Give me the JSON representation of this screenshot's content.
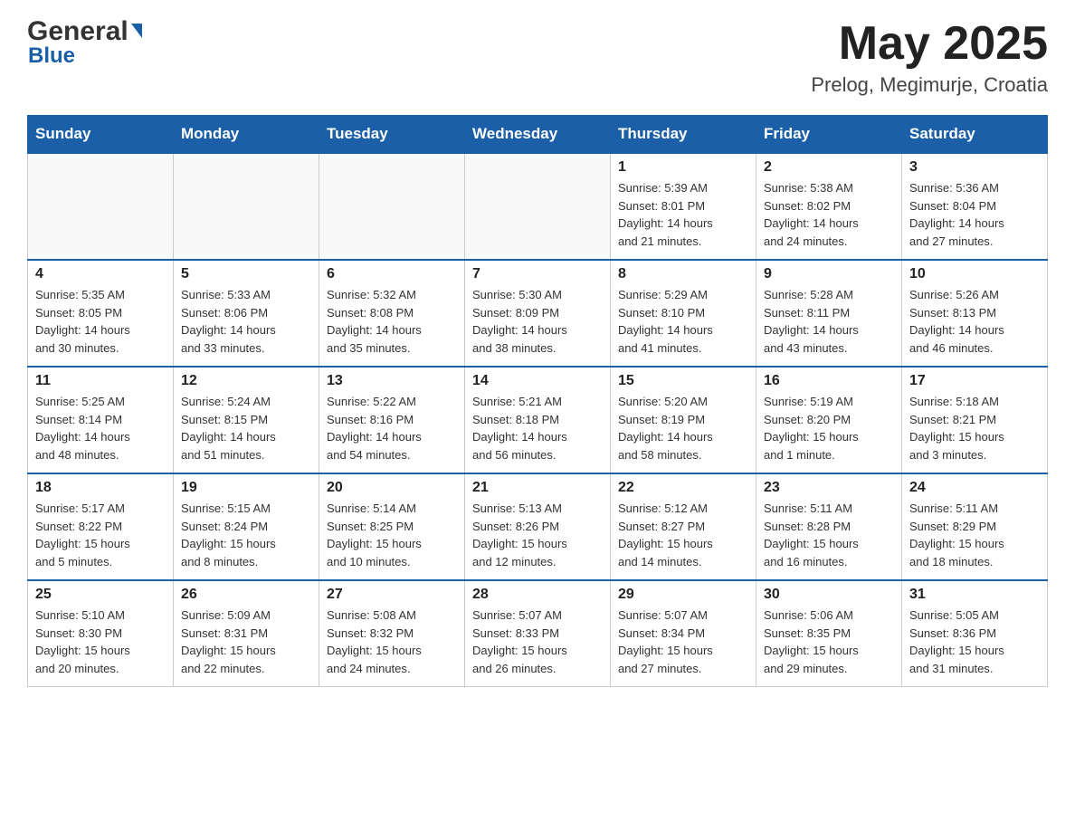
{
  "header": {
    "logo_general": "General",
    "logo_blue": "Blue",
    "month_year": "May 2025",
    "location": "Prelog, Megimurje, Croatia"
  },
  "calendar": {
    "days_of_week": [
      "Sunday",
      "Monday",
      "Tuesday",
      "Wednesday",
      "Thursday",
      "Friday",
      "Saturday"
    ],
    "weeks": [
      [
        {
          "day": "",
          "info": ""
        },
        {
          "day": "",
          "info": ""
        },
        {
          "day": "",
          "info": ""
        },
        {
          "day": "",
          "info": ""
        },
        {
          "day": "1",
          "info": "Sunrise: 5:39 AM\nSunset: 8:01 PM\nDaylight: 14 hours\nand 21 minutes."
        },
        {
          "day": "2",
          "info": "Sunrise: 5:38 AM\nSunset: 8:02 PM\nDaylight: 14 hours\nand 24 minutes."
        },
        {
          "day": "3",
          "info": "Sunrise: 5:36 AM\nSunset: 8:04 PM\nDaylight: 14 hours\nand 27 minutes."
        }
      ],
      [
        {
          "day": "4",
          "info": "Sunrise: 5:35 AM\nSunset: 8:05 PM\nDaylight: 14 hours\nand 30 minutes."
        },
        {
          "day": "5",
          "info": "Sunrise: 5:33 AM\nSunset: 8:06 PM\nDaylight: 14 hours\nand 33 minutes."
        },
        {
          "day": "6",
          "info": "Sunrise: 5:32 AM\nSunset: 8:08 PM\nDaylight: 14 hours\nand 35 minutes."
        },
        {
          "day": "7",
          "info": "Sunrise: 5:30 AM\nSunset: 8:09 PM\nDaylight: 14 hours\nand 38 minutes."
        },
        {
          "day": "8",
          "info": "Sunrise: 5:29 AM\nSunset: 8:10 PM\nDaylight: 14 hours\nand 41 minutes."
        },
        {
          "day": "9",
          "info": "Sunrise: 5:28 AM\nSunset: 8:11 PM\nDaylight: 14 hours\nand 43 minutes."
        },
        {
          "day": "10",
          "info": "Sunrise: 5:26 AM\nSunset: 8:13 PM\nDaylight: 14 hours\nand 46 minutes."
        }
      ],
      [
        {
          "day": "11",
          "info": "Sunrise: 5:25 AM\nSunset: 8:14 PM\nDaylight: 14 hours\nand 48 minutes."
        },
        {
          "day": "12",
          "info": "Sunrise: 5:24 AM\nSunset: 8:15 PM\nDaylight: 14 hours\nand 51 minutes."
        },
        {
          "day": "13",
          "info": "Sunrise: 5:22 AM\nSunset: 8:16 PM\nDaylight: 14 hours\nand 54 minutes."
        },
        {
          "day": "14",
          "info": "Sunrise: 5:21 AM\nSunset: 8:18 PM\nDaylight: 14 hours\nand 56 minutes."
        },
        {
          "day": "15",
          "info": "Sunrise: 5:20 AM\nSunset: 8:19 PM\nDaylight: 14 hours\nand 58 minutes."
        },
        {
          "day": "16",
          "info": "Sunrise: 5:19 AM\nSunset: 8:20 PM\nDaylight: 15 hours\nand 1 minute."
        },
        {
          "day": "17",
          "info": "Sunrise: 5:18 AM\nSunset: 8:21 PM\nDaylight: 15 hours\nand 3 minutes."
        }
      ],
      [
        {
          "day": "18",
          "info": "Sunrise: 5:17 AM\nSunset: 8:22 PM\nDaylight: 15 hours\nand 5 minutes."
        },
        {
          "day": "19",
          "info": "Sunrise: 5:15 AM\nSunset: 8:24 PM\nDaylight: 15 hours\nand 8 minutes."
        },
        {
          "day": "20",
          "info": "Sunrise: 5:14 AM\nSunset: 8:25 PM\nDaylight: 15 hours\nand 10 minutes."
        },
        {
          "day": "21",
          "info": "Sunrise: 5:13 AM\nSunset: 8:26 PM\nDaylight: 15 hours\nand 12 minutes."
        },
        {
          "day": "22",
          "info": "Sunrise: 5:12 AM\nSunset: 8:27 PM\nDaylight: 15 hours\nand 14 minutes."
        },
        {
          "day": "23",
          "info": "Sunrise: 5:11 AM\nSunset: 8:28 PM\nDaylight: 15 hours\nand 16 minutes."
        },
        {
          "day": "24",
          "info": "Sunrise: 5:11 AM\nSunset: 8:29 PM\nDaylight: 15 hours\nand 18 minutes."
        }
      ],
      [
        {
          "day": "25",
          "info": "Sunrise: 5:10 AM\nSunset: 8:30 PM\nDaylight: 15 hours\nand 20 minutes."
        },
        {
          "day": "26",
          "info": "Sunrise: 5:09 AM\nSunset: 8:31 PM\nDaylight: 15 hours\nand 22 minutes."
        },
        {
          "day": "27",
          "info": "Sunrise: 5:08 AM\nSunset: 8:32 PM\nDaylight: 15 hours\nand 24 minutes."
        },
        {
          "day": "28",
          "info": "Sunrise: 5:07 AM\nSunset: 8:33 PM\nDaylight: 15 hours\nand 26 minutes."
        },
        {
          "day": "29",
          "info": "Sunrise: 5:07 AM\nSunset: 8:34 PM\nDaylight: 15 hours\nand 27 minutes."
        },
        {
          "day": "30",
          "info": "Sunrise: 5:06 AM\nSunset: 8:35 PM\nDaylight: 15 hours\nand 29 minutes."
        },
        {
          "day": "31",
          "info": "Sunrise: 5:05 AM\nSunset: 8:36 PM\nDaylight: 15 hours\nand 31 minutes."
        }
      ]
    ]
  }
}
